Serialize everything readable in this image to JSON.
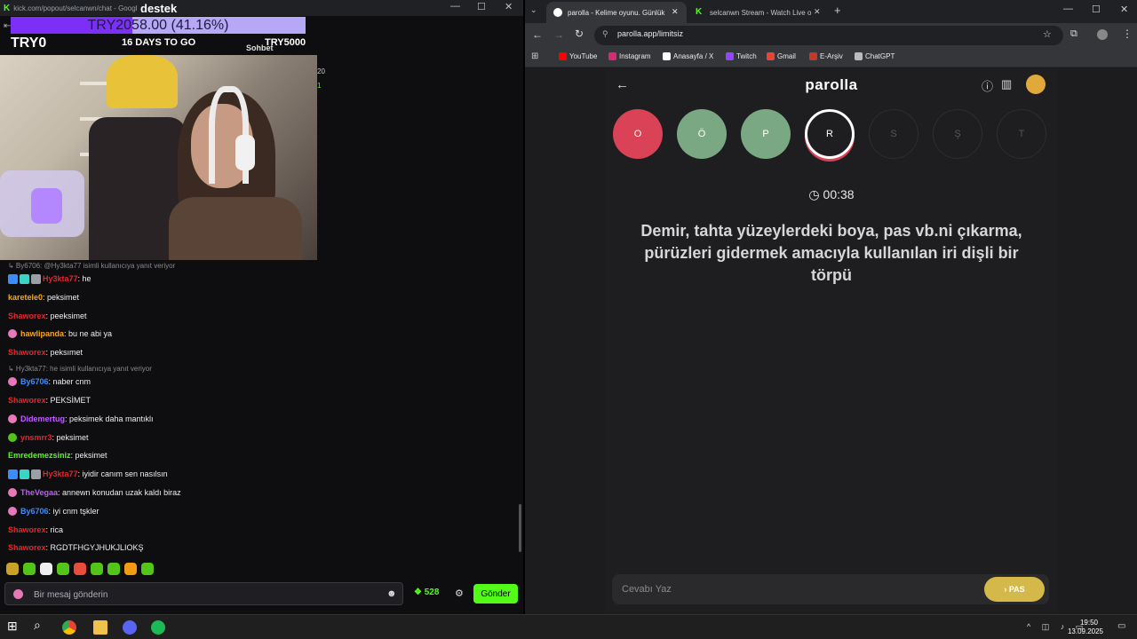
{
  "left_window": {
    "title_url": "kick.com/popout/selcanwn/chat - Googl",
    "goal_text": "TRY2058.00 (41.16%)",
    "goal_percent": 41.16,
    "destek": "destek",
    "start_amount": "TRY0",
    "days_left": "16 DAYS TO GO",
    "sohbet": "Sohbet",
    "target_amount": "TRY5000",
    "side_num1": "20",
    "side_num2": "1"
  },
  "chat": {
    "messages": [
      {
        "kind": "reply",
        "text": "By6706: @Hy3kta77 isimli kullanıcıya yanıt veriyor"
      },
      {
        "kind": "msg",
        "badges": [
          "sq-blue",
          "sq-teal",
          "bag"
        ],
        "user": "Hy3kta77",
        "color": "#e5262c",
        "text": ": he"
      },
      {
        "kind": "msg",
        "badges": [],
        "user": "karetele0",
        "color": "#f5a623",
        "text": ": peksimet"
      },
      {
        "kind": "msg",
        "badges": [],
        "user": "Shaworex",
        "color": "#e5262c",
        "text": ": peeksimet"
      },
      {
        "kind": "msg",
        "badges": [
          "pink"
        ],
        "user": "hawlipanda",
        "color": "#f5a623",
        "text": ": bu ne abi ya"
      },
      {
        "kind": "msg",
        "badges": [],
        "user": "Shaworex",
        "color": "#e5262c",
        "text": ": peksımet"
      },
      {
        "kind": "reply",
        "text": "Hy3kta77: he isimli kullanıcıya yanıt veriyor"
      },
      {
        "kind": "msg",
        "badges": [
          "pink"
        ],
        "user": "By6706",
        "color": "#3b8cff",
        "text": ": naber cnm"
      },
      {
        "kind": "msg",
        "badges": [],
        "user": "Shaworex",
        "color": "#e5262c",
        "text": ": PEKSİMET"
      },
      {
        "kind": "msg",
        "badges": [
          "pink"
        ],
        "user": "Didemertug",
        "color": "#c05cff",
        "text": ": peksimek daha mantıklı"
      },
      {
        "kind": "msg",
        "badges": [
          "green"
        ],
        "user": "ynsmrr3",
        "color": "#e5262c",
        "text": ": peksimet"
      },
      {
        "kind": "msg",
        "badges": [],
        "user": "Emredemezsiniz",
        "color": "#53fc18",
        "text": ": peksimet"
      },
      {
        "kind": "msg",
        "badges": [
          "sq-blue",
          "sq-teal",
          "bag"
        ],
        "user": "Hy3kta77",
        "color": "#e5262c",
        "text": ": iyidir canım sen nasılsın"
      },
      {
        "kind": "msg",
        "badges": [
          "pink"
        ],
        "user": "TheVegaa",
        "color": "#c05cff",
        "text": ": annewn konudan uzak kaldı biraz"
      },
      {
        "kind": "msg",
        "badges": [
          "pink"
        ],
        "user": "By6706",
        "color": "#3b8cff",
        "text": ": iyi cnm tşkler"
      },
      {
        "kind": "msg",
        "badges": [],
        "user": "Shaworex",
        "color": "#e5262c",
        "text": ": rica"
      },
      {
        "kind": "msg",
        "badges": [],
        "user": "Shaworex",
        "color": "#e5262c",
        "text": ": RGDTFHGYJHUKJLIOKŞ"
      }
    ],
    "input_placeholder": "Bir mesaj gönderin",
    "points": "528",
    "send_label": "Gönder"
  },
  "browser": {
    "tabs": [
      {
        "label": "parolla - Kelime oyunu. Günlük"
      },
      {
        "label": "selcanwn Stream - Watch Live o"
      }
    ],
    "url": "parolla.app/limitsiz",
    "bookmarks": [
      {
        "label": "YouTube",
        "color": "#ff0000"
      },
      {
        "label": "Instagram",
        "color": "#d62976"
      },
      {
        "label": "Anasayfa / X",
        "color": "#ffffff"
      },
      {
        "label": "Twitch",
        "color": "#9146ff"
      },
      {
        "label": "Gmail",
        "color": "#ea4335"
      },
      {
        "label": "E-Arşiv",
        "color": "#c0392b"
      },
      {
        "label": "ChatGPT",
        "color": "#bbbbbb"
      }
    ]
  },
  "game": {
    "title": "parolla",
    "letters": [
      {
        "letter": "O",
        "state": "wrong"
      },
      {
        "letter": "Ö",
        "state": "correct"
      },
      {
        "letter": "P",
        "state": "correct"
      },
      {
        "letter": "R",
        "state": "current"
      },
      {
        "letter": "S",
        "state": "pending"
      },
      {
        "letter": "Ş",
        "state": "pending"
      },
      {
        "letter": "T",
        "state": "pending"
      }
    ],
    "timer": "00:38",
    "question": "Demir, tahta yüzeylerdeki boya, pas vb.ni çıkarma, pürüzleri gidermek amacıyla kullanılan iri dişli bir törpü",
    "answer_placeholder": "Cevabı Yaz",
    "pass_label": "PAS"
  },
  "taskbar": {
    "time": "19:50",
    "date": "13.09.2025"
  },
  "colors": {
    "kick_green": "#53fc18",
    "wrong": "#d94257",
    "correct": "#7aa882",
    "pass": "#d4b94a"
  }
}
